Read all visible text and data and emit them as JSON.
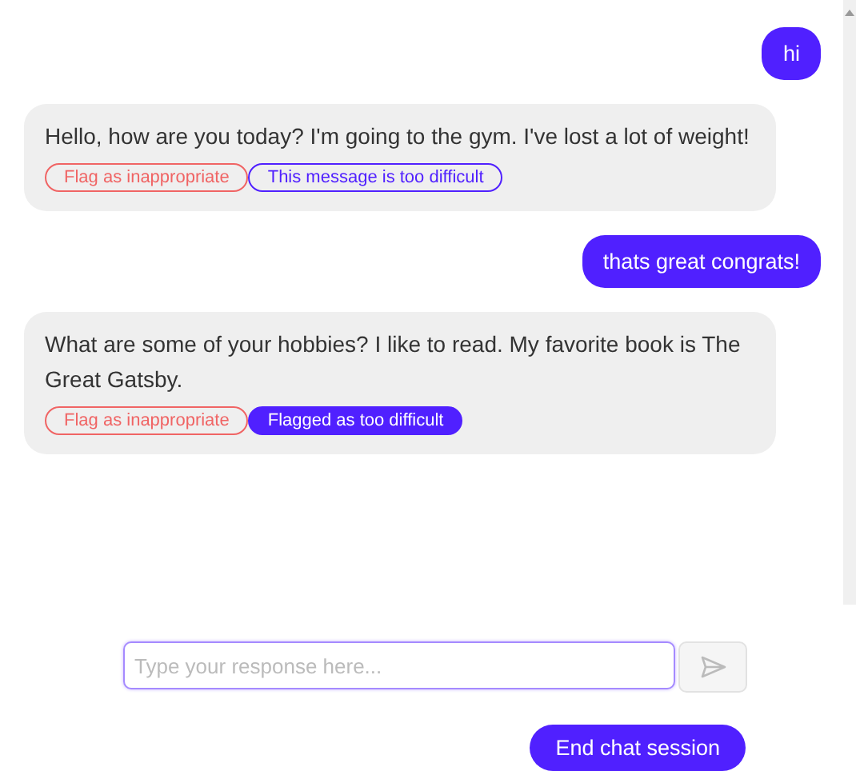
{
  "messages": [
    {
      "kind": "user",
      "text": "hi"
    },
    {
      "kind": "bot",
      "text": "Hello, how are you today? I'm going to the gym. I've lost a lot of weight!",
      "flags": [
        {
          "kind": "inappropriate",
          "label": "Flag as inappropriate",
          "selected": false
        },
        {
          "kind": "difficult",
          "label": "This message is too difficult",
          "selected": false
        }
      ]
    },
    {
      "kind": "user",
      "text": "thats great congrats!"
    },
    {
      "kind": "bot",
      "text": "What are some of your hobbies? I like to read. My favorite book is The Great Gatsby.",
      "flags": [
        {
          "kind": "inappropriate",
          "label": "Flag as inappropriate",
          "selected": false
        },
        {
          "kind": "difficult",
          "label": "Flagged as too difficult",
          "selected": true
        }
      ]
    }
  ],
  "composer": {
    "placeholder": "Type your response here..."
  },
  "end_button": "End chat session"
}
